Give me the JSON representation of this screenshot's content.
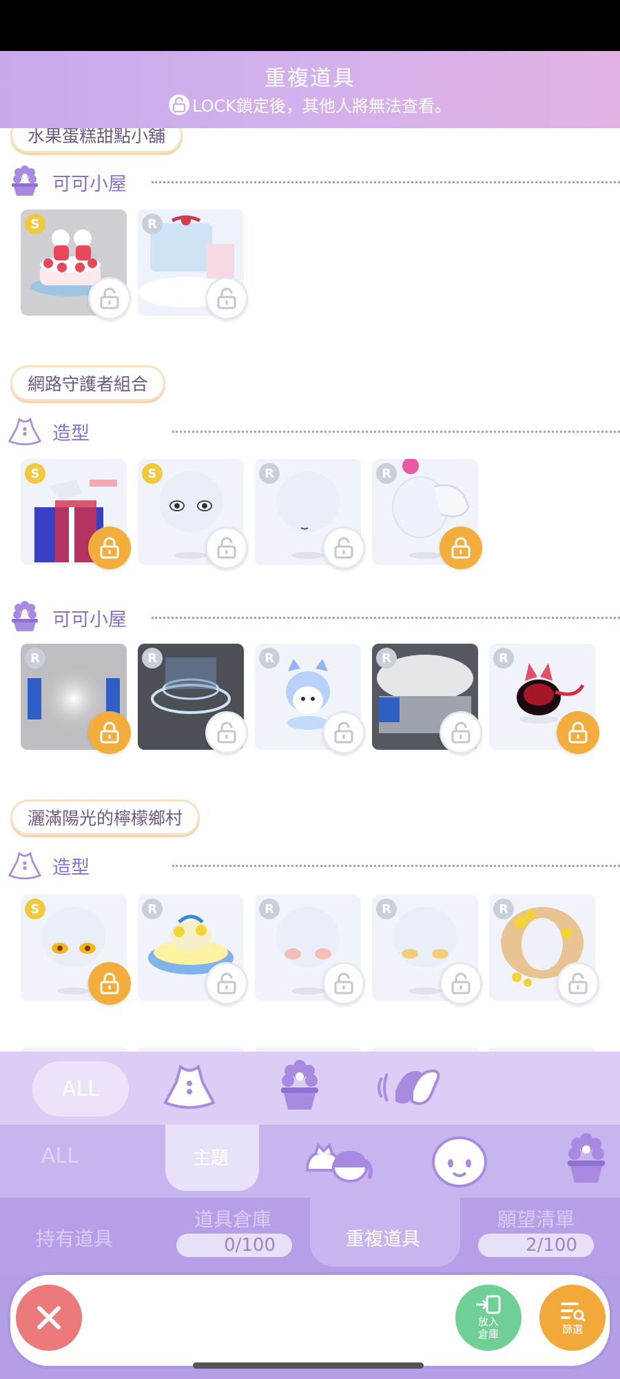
{
  "header": {
    "title": "重複道具",
    "subtitle": "LOCK鎖定後，其他人將無法查看。"
  },
  "sections": [
    {
      "set_name": "水果蛋糕甜點小舖",
      "categories": [
        {
          "label": "可可小屋",
          "icon": "flower-pot-icon",
          "items": [
            {
              "rarity": "S",
              "locked": false,
              "bg": "gray",
              "desc": "strawberry-cake"
            },
            {
              "rarity": "R",
              "locked": false,
              "bg": "light",
              "desc": "ribbon-room"
            }
          ]
        }
      ]
    },
    {
      "set_name": "網路守護者組合",
      "categories": [
        {
          "label": "造型",
          "icon": "dress-icon",
          "items": [
            {
              "rarity": "S",
              "locked": true,
              "bg": "light",
              "desc": "cyber-outfit"
            },
            {
              "rarity": "S",
              "locked": false,
              "bg": "light",
              "desc": "eyes"
            },
            {
              "rarity": "R",
              "locked": false,
              "bg": "light",
              "desc": "face"
            },
            {
              "rarity": "R",
              "locked": true,
              "bg": "light",
              "desc": "tail"
            }
          ]
        },
        {
          "label": "可可小屋",
          "icon": "flower-pot-icon",
          "items": [
            {
              "rarity": "R",
              "locked": true,
              "bg": "gray",
              "desc": "light-room"
            },
            {
              "rarity": "R",
              "locked": false,
              "bg": "dark",
              "desc": "ring-platform"
            },
            {
              "rarity": "R",
              "locked": false,
              "bg": "light",
              "desc": "ghost-pet"
            },
            {
              "rarity": "R",
              "locked": false,
              "bg": "dark",
              "desc": "tech-hall"
            },
            {
              "rarity": "R",
              "locked": true,
              "bg": "light",
              "desc": "red-creature"
            }
          ]
        }
      ]
    },
    {
      "set_name": "灑滿陽光的檸檬鄉村",
      "categories": [
        {
          "label": "造型",
          "icon": "dress-icon",
          "items": [
            {
              "rarity": "S",
              "locked": true,
              "bg": "light",
              "desc": "golden-eyes"
            },
            {
              "rarity": "R",
              "locked": false,
              "bg": "light",
              "desc": "lemon-hat"
            },
            {
              "rarity": "R",
              "locked": false,
              "bg": "light",
              "desc": "pink-blush"
            },
            {
              "rarity": "R",
              "locked": false,
              "bg": "light",
              "desc": "yellow-blush"
            },
            {
              "rarity": "R",
              "locked": false,
              "bg": "light",
              "desc": "straw-hat"
            }
          ]
        }
      ]
    }
  ],
  "filter_row1": {
    "all_label": "ALL"
  },
  "filter_row2": {
    "all_label": "ALL",
    "theme_label": "主題"
  },
  "tabs": {
    "owned": "持有道具",
    "warehouse": "道具倉庫",
    "warehouse_count": "0/100",
    "duplicate": "重複道具",
    "wishlist": "願望清單",
    "wishlist_count": "2/100"
  },
  "actions": {
    "store_label_1": "放入",
    "store_label_2": "倉庫",
    "filter_label": "篩選"
  },
  "colors": {
    "accent": "#b69fe6",
    "lock_on": "#f3ad3c",
    "close": "#ec7a7a",
    "store": "#6fcf97",
    "filter": "#f3a93a"
  }
}
